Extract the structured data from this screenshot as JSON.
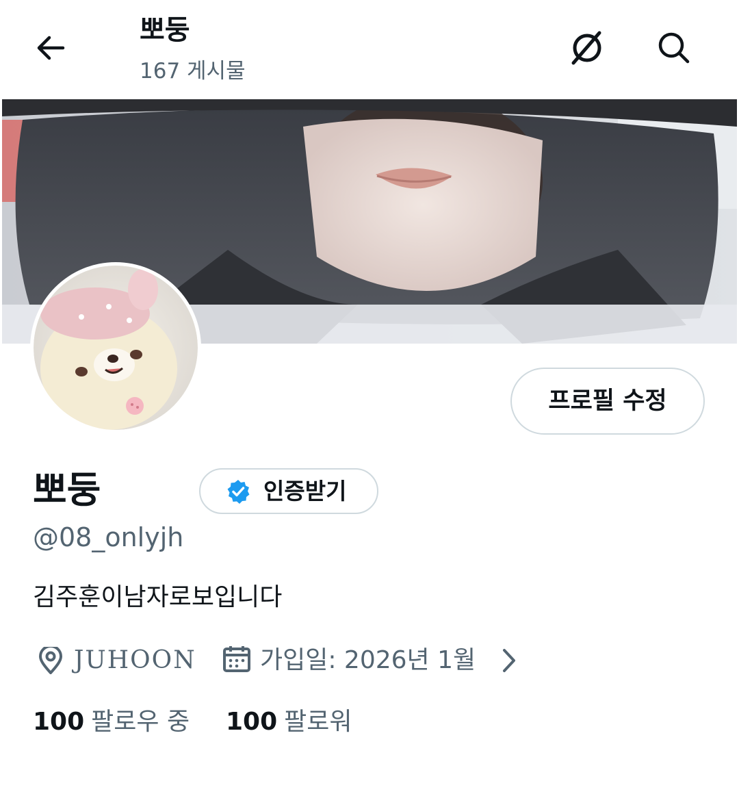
{
  "header": {
    "title": "뽀둥",
    "post_count": "167 게시물",
    "icons": [
      "back-arrow-icon",
      "circle-slash-icon",
      "search-icon"
    ]
  },
  "profile": {
    "display_name": "뽀둥",
    "handle": "@08_onlyjh",
    "bio": "김주훈이남자로보입니다",
    "edit_button": "프로필 수정",
    "verify_button": "인증받기",
    "location": "JUHOON",
    "joined": "가입일: 2026년 1월",
    "following_count": "100",
    "following_label": "팔로우 중",
    "followers_count": "100",
    "followers_label": "팔로워"
  },
  "colors": {
    "text_primary": "#0f1419",
    "text_secondary": "#536471",
    "border": "#cfd9de",
    "verified_blue": "#1d9bf0"
  }
}
